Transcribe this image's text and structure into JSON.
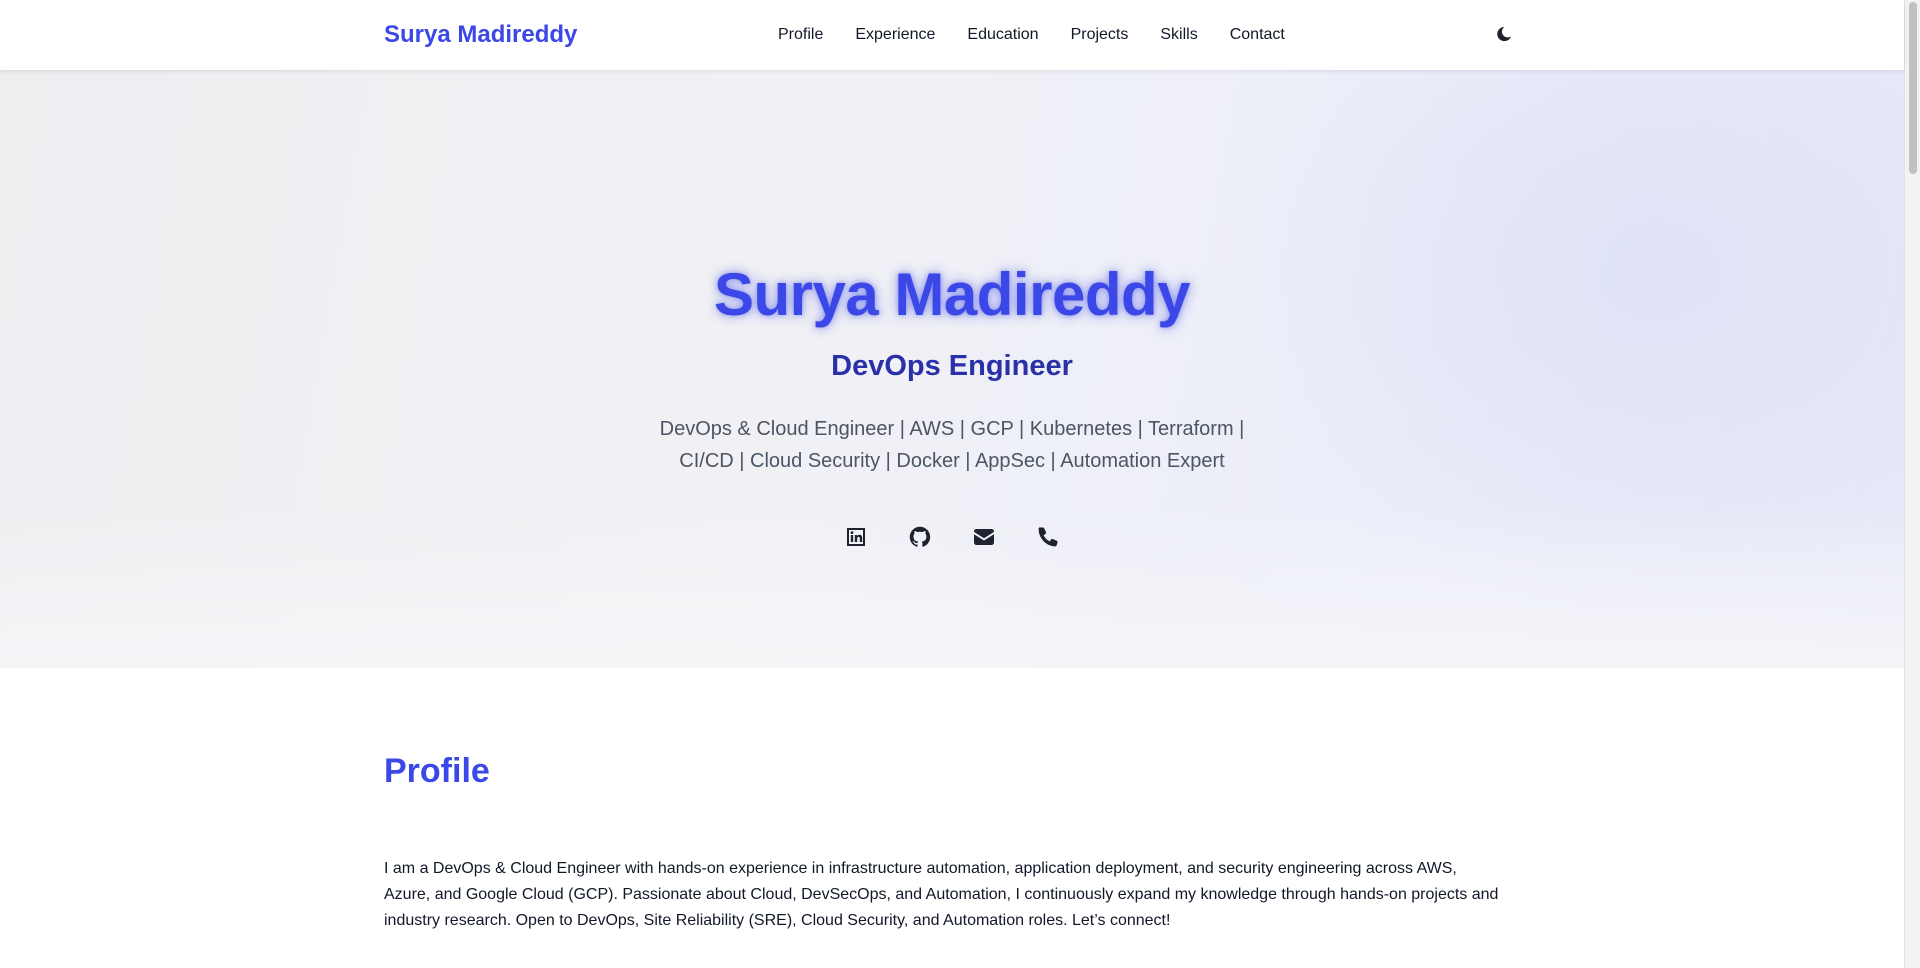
{
  "nav": {
    "brand": "Surya Madireddy",
    "links": [
      "Profile",
      "Experience",
      "Education",
      "Projects",
      "Skills",
      "Contact"
    ],
    "theme_toggle_icon": "moon-icon"
  },
  "hero": {
    "name": "Surya Madireddy",
    "title": "DevOps Engineer",
    "tagline": "DevOps & Cloud Engineer | AWS | GCP | Kubernetes | Terraform | CI/CD | Cloud Security | Docker | AppSec | Automation Expert",
    "socials": [
      "linkedin-icon",
      "github-icon",
      "email-icon",
      "phone-icon"
    ]
  },
  "profile": {
    "heading": "Profile",
    "text": "I am a DevOps & Cloud Engineer with hands-on experience in infrastructure automation, application deployment, and security engineering across AWS, Azure, and Google Cloud (GCP). Passionate about Cloud, DevSecOps, and Automation, I continuously expand my knowledge through hands-on projects and industry research. Open to DevOps, Site Reliability (SRE), Cloud Security, and Automation roles. Let’s connect!"
  },
  "colors": {
    "accent": "#3b47e6",
    "subtitle": "#2a30a8",
    "text": "#111827",
    "muted": "#4b5563"
  }
}
